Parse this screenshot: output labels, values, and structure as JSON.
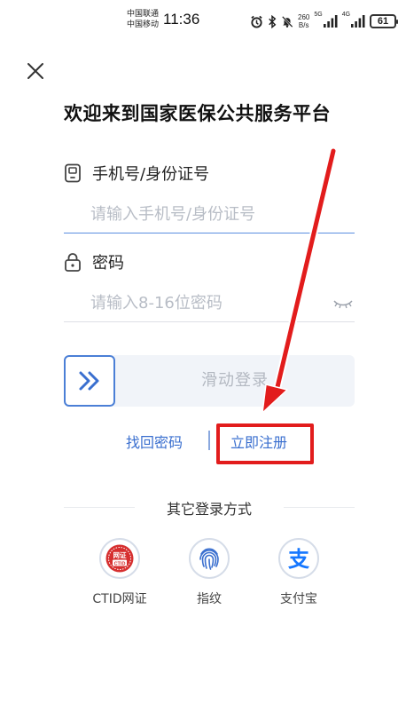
{
  "status_bar": {
    "carrier_1": "中国联通",
    "carrier_2": "中国移动",
    "time": "11:36",
    "net_speed_value": "260",
    "net_speed_unit": "B/s",
    "sig_5g": "5G",
    "sig_4g": "4G",
    "battery": "61"
  },
  "page": {
    "title": "欢迎来到国家医保公共服务平台"
  },
  "account_field": {
    "label": "手机号/身份证号",
    "placeholder": "请输入手机号/身份证号",
    "value": ""
  },
  "password_field": {
    "label": "密码",
    "placeholder": "请输入8-16位密码",
    "value": ""
  },
  "slider": {
    "label": "滑动登录",
    "progress": 0
  },
  "links": {
    "forgot_password": "找回密码",
    "register": "立即注册"
  },
  "other_login": {
    "title": "其它登录方式",
    "methods": [
      {
        "label": "CTID网证",
        "icon": "ctid-badge-icon",
        "badge_top": "网证",
        "badge_bottom": "CTID"
      },
      {
        "label": "指纹",
        "icon": "fingerprint-icon"
      },
      {
        "label": "支付宝",
        "icon": "alipay-icon",
        "glyph": "支"
      }
    ]
  },
  "colors": {
    "accent_blue": "#3a6fcf",
    "slider_border": "#4b7fd6",
    "annotation_red": "#e21c1c",
    "ctid_red": "#d62f2f",
    "alipay_blue": "#1677ff"
  }
}
